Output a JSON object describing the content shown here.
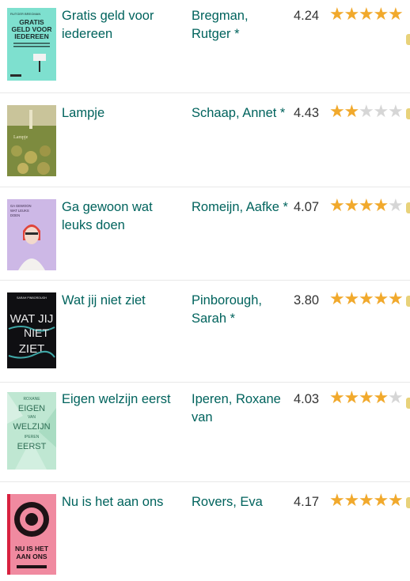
{
  "books": [
    {
      "title": "Gratis geld voor iedereen",
      "author": "Bregman, Rutger *",
      "avg_rating": "4.24",
      "user_stars": 5
    },
    {
      "title": "Lampje",
      "author": "Schaap, Annet *",
      "avg_rating": "4.43",
      "user_stars": 2
    },
    {
      "title": "Ga gewoon wat leuks doen",
      "author": "Romeijn, Aafke *",
      "avg_rating": "4.07",
      "user_stars": 4
    },
    {
      "title": "Wat jij niet ziet",
      "author": "Pinborough, Sarah *",
      "avg_rating": "3.80",
      "user_stars": 5
    },
    {
      "title": "Eigen welzijn eerst",
      "author": "Iperen, Roxane van",
      "avg_rating": "4.03",
      "user_stars": 4
    },
    {
      "title": "Nu is het aan ons",
      "author": "Rovers, Eva",
      "avg_rating": "4.17",
      "user_stars": 5
    }
  ],
  "covers": [
    {
      "top_text": "RUTGER BREGMAN",
      "lines": [
        "GRATIS",
        "GELD VOOR",
        "IEDEREEN"
      ],
      "bg": "#7ee0cf",
      "ink": "#1b2a2a"
    },
    {
      "lines": [
        "Lampje"
      ],
      "bg": "#7d8b3f",
      "ink": "#efe9c8"
    },
    {
      "lines": [
        "GA GEWOON",
        "WAT LEUKS",
        "DOEN"
      ],
      "bg": "#cdb8e6",
      "ink": "#3a2a4a"
    },
    {
      "top_text": "SARAH PINBOROUGH",
      "lines": [
        "WAT JIJ",
        "NIET",
        "ZIET"
      ],
      "bg": "#0f0f12",
      "ink": "#e9e9ea"
    },
    {
      "lines": [
        "ROXANE",
        "EIGEN",
        "VAN",
        "WELZIJN",
        "IPEREN",
        "EERST"
      ],
      "bg": "#bfe7d2",
      "ink": "#2f6e55"
    },
    {
      "lines": [
        "NU IS HET",
        "AAN ONS"
      ],
      "bg": "#f08aa0",
      "ink": "#1e1216"
    }
  ],
  "colors": {
    "link": "#00635d",
    "star_on": "#f1a92c",
    "star_off": "#d6d6d6",
    "divider": "#e8e8e8"
  },
  "icons": {
    "star": "star-icon"
  }
}
